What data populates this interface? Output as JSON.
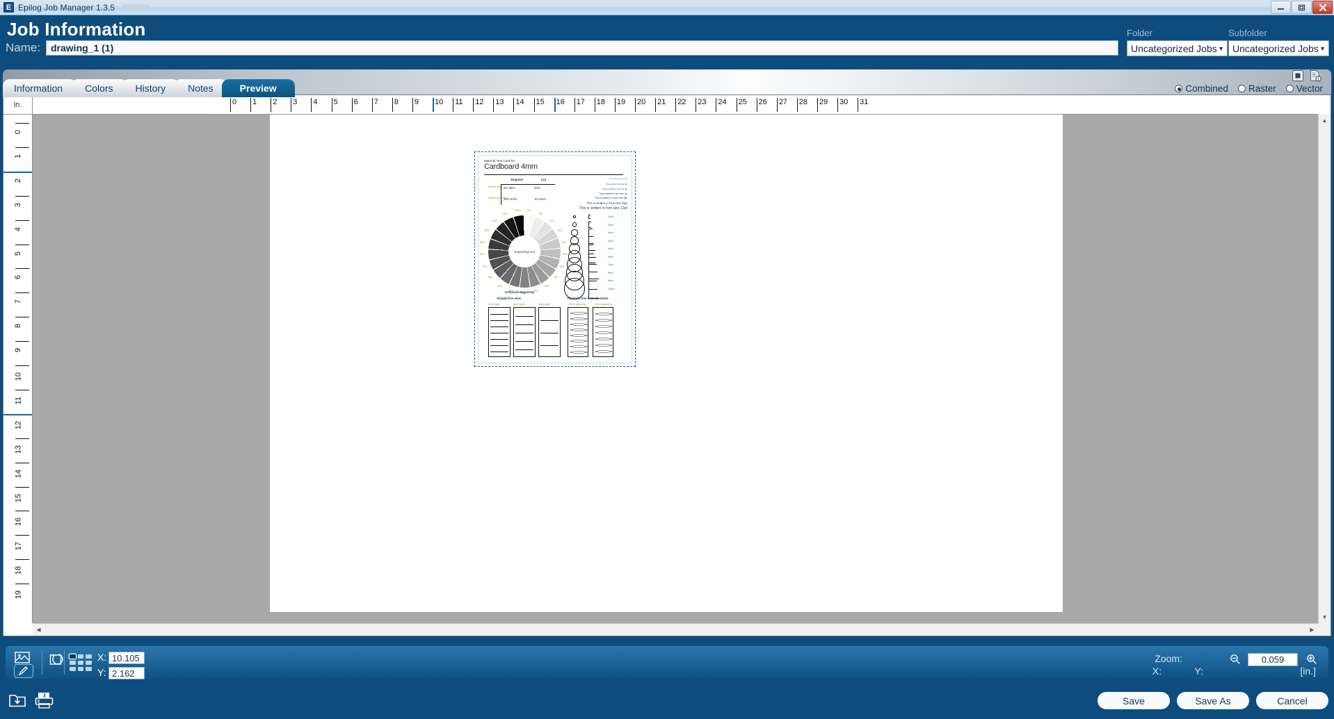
{
  "window": {
    "title": "Epilog Job Manager 1.3.5",
    "app_badge": "E",
    "controls": {
      "minimize": "—",
      "maximize": "❐",
      "close": "✕"
    }
  },
  "header": {
    "title": "Job Information",
    "name_label": "Name:",
    "name_value": "drawing_1 (1)",
    "folder": {
      "label": "Folder",
      "value": "Uncategorized Jobs",
      "caret": "▼"
    },
    "subfolder": {
      "label": "Subfolder",
      "value": "Uncategorized Jobs",
      "caret": "▼"
    }
  },
  "tabs": [
    {
      "label": "Information",
      "active": false
    },
    {
      "label": "Colors",
      "active": false
    },
    {
      "label": "History",
      "active": false
    },
    {
      "label": "Notes",
      "active": false
    },
    {
      "label": "Preview",
      "active": true
    }
  ],
  "view_modes": {
    "icons": [
      "stop-square-icon",
      "page-count-icon"
    ],
    "page_count": "1",
    "options": [
      {
        "label": "Combined",
        "selected": true
      },
      {
        "label": "Raster",
        "selected": false
      },
      {
        "label": "Vector",
        "selected": false
      }
    ]
  },
  "rulers": {
    "unit_corner": "in.",
    "horizontal": [
      "0",
      "1",
      "2",
      "3",
      "4",
      "5",
      "6",
      "7",
      "8",
      "9",
      "10",
      "11",
      "12",
      "13",
      "14",
      "15",
      "16",
      "17",
      "18",
      "19",
      "20",
      "21",
      "22",
      "23",
      "24",
      "25",
      "26",
      "27",
      "28",
      "29",
      "30",
      "31"
    ],
    "horizontal_highlights": [
      "10",
      "16"
    ],
    "vertical": [
      "0",
      "1",
      "2",
      "3",
      "4",
      "5",
      "6",
      "7",
      "8",
      "9",
      "10",
      "11",
      "12",
      "13",
      "14",
      "15",
      "16",
      "17",
      "18",
      "19"
    ],
    "vertical_highlights": [
      "2",
      "12"
    ]
  },
  "artwork": {
    "subtitle": "Material Test Card for",
    "title": "Cardboard 4mm",
    "params_table": {
      "columns": [
        "Engrave",
        "Cut"
      ],
      "rows": [
        {
          "label": "Power [%]",
          "engrave": "0%   35%",
          "cut": "30%"
        },
        {
          "label": "Speed [mm/s]",
          "engrave": "300 mm/s",
          "cut": "10 mm/s"
        }
      ]
    },
    "font_samples": [
      "This is written in font size 4pt",
      "This is written in font size 5pt",
      "This is written in font size 6pt",
      "This is written in font size 7pt",
      "This is written in font size 8pt",
      "This is written in font size 10pt",
      "This is written in font size 12pt"
    ],
    "donut": {
      "center_label": "Engraving tool",
      "caption": "Greyscale Engraving",
      "labels": [
        "0%",
        "5%",
        "10%",
        "15%",
        "20%",
        "25%",
        "30%",
        "35%",
        "40%",
        "45%",
        "50%",
        "55%",
        "60%",
        "65%",
        "70%",
        "75%",
        "80%",
        "85%",
        "90%",
        "95%",
        "100%"
      ]
    },
    "shape_tests": {
      "sizes": [
        "1mm",
        "2mm",
        "3mm",
        "4mm",
        "5mm",
        "6mm",
        "7mm",
        "8mm",
        "9mm",
        "10mm"
      ]
    },
    "line_tests": {
      "straight": {
        "title": "Straight line tests",
        "columns": [
          "2mm gap",
          "3mm gap",
          "4mm gap"
        ]
      },
      "parabolic": {
        "title": "Parabolic line tests 10x15mm",
        "columns": [
          "3mm spacing",
          "4mm spacing"
        ]
      }
    }
  },
  "statusbar": {
    "icons": [
      "image-tool-icon",
      "pencil-tool-icon",
      "rotate-tool-icon"
    ],
    "x_label": "X:",
    "x_value": "10.105",
    "y_label": "Y:",
    "y_value": "2.162",
    "zoom_label": "Zoom:",
    "zoom_value": "0.059",
    "zoom_out_icon": "magnifier-minus-icon",
    "zoom_in_icon": "magnifier-plus-icon",
    "pointer_x_label": "X:",
    "pointer_y_label": "Y:",
    "unit": "[in.]"
  },
  "footer": {
    "import_icon": "import-folder-icon",
    "print_icon": "send-to-laser-icon",
    "save": "Save",
    "save_as": "Save As",
    "cancel": "Cancel"
  },
  "colors": {
    "brand_dark": "#0e4c7d",
    "brand_mid": "#1a6fa6",
    "canvas_gray": "#a8a8a8",
    "selection_blue": "#1552a8"
  }
}
